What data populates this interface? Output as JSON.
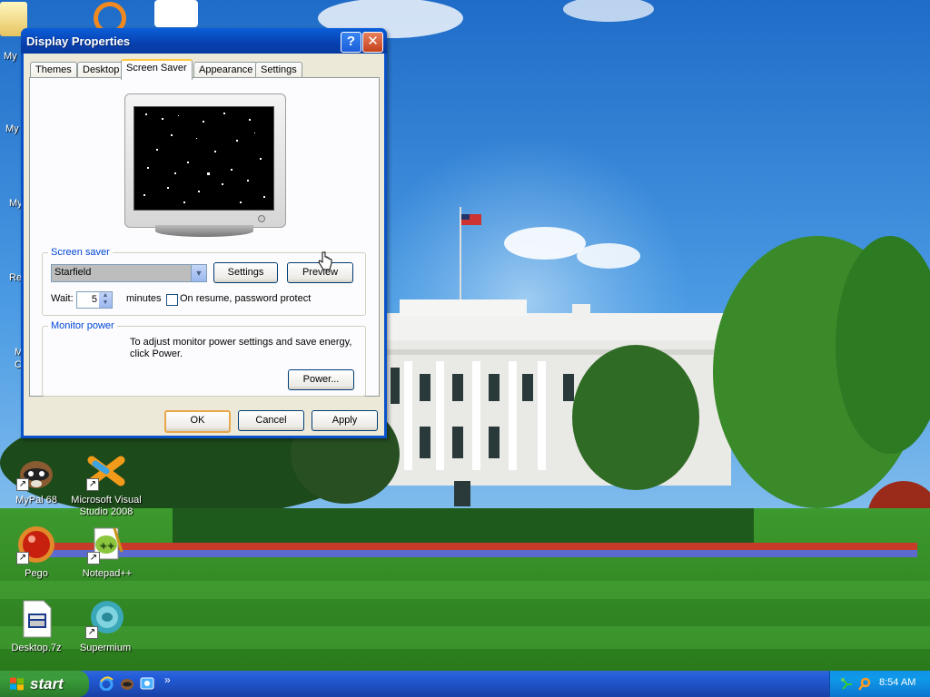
{
  "desktop": {
    "icons": [
      {
        "label": "MyPal 68",
        "icon": "raccoon-icon"
      },
      {
        "label": "Microsoft Visual Studio 2008",
        "icon": "visual-studio-icon"
      },
      {
        "label": "Pego",
        "icon": "red-ball-icon"
      },
      {
        "label": "Notepad++",
        "icon": "notepad-plus-icon"
      },
      {
        "label": "Desktop.7z",
        "icon": "archive-file-icon"
      },
      {
        "label": "Supermium",
        "icon": "supermium-icon"
      }
    ],
    "partial_labels": [
      "My",
      "My",
      "My",
      "Re",
      "M",
      "C"
    ]
  },
  "dialog": {
    "title": "Display Properties",
    "help_label": "?",
    "close_label": "✕",
    "tabs": [
      {
        "label": "Themes"
      },
      {
        "label": "Desktop"
      },
      {
        "label": "Screen Saver"
      },
      {
        "label": "Appearance"
      },
      {
        "label": "Settings"
      }
    ],
    "active_tab": "Screen Saver",
    "screen_saver": {
      "group_label": "Screen saver",
      "selected": "Starfield",
      "settings_label": "Settings",
      "preview_label": "Preview",
      "wait_label": "Wait:",
      "wait_value": "5",
      "minutes_label": "minutes",
      "password_label": "On resume, password protect",
      "password_checked": false
    },
    "monitor_power": {
      "group_label": "Monitor power",
      "description": "To adjust monitor power settings and save energy, click Power.",
      "power_label": "Power..."
    },
    "buttons": {
      "ok": "OK",
      "cancel": "Cancel",
      "apply": "Apply"
    }
  },
  "taskbar": {
    "start_label": "start",
    "quick_launch": [
      "internet-explorer-icon",
      "mypal-icon",
      "explorer-icon"
    ],
    "chevron": "»",
    "clock": "8:54 AM",
    "tray_icons": [
      "network-icon",
      "search-icon"
    ]
  }
}
